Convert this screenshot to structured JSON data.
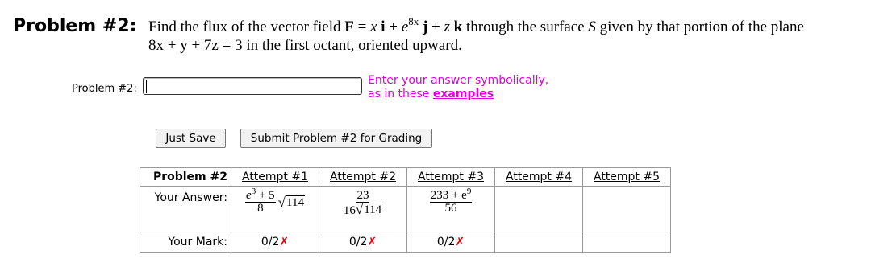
{
  "problem": {
    "label": "Problem #2:",
    "line1": {
      "pre": "Find the flux of the vector field",
      "F": "F",
      "eq": "=",
      "x": "x",
      "i": "i",
      "plus1": "+",
      "e": "e",
      "exp": "8x",
      "j": "j",
      "plus2": "+",
      "z": "z",
      "k": "k",
      "mid": "through the surface",
      "S": "S",
      "post": "given by that portion of the plane"
    },
    "line2": {
      "eqn": "8x + y + 7z = 3",
      "post": "in the first octant, oriented upward."
    }
  },
  "answer": {
    "label": "Problem #2:",
    "value": "",
    "hint_line1": "Enter your answer symbolically,",
    "hint_line2": "as in these",
    "hint_link": "examples"
  },
  "buttons": {
    "save": "Just Save",
    "submit": "Submit Problem #2 for Grading"
  },
  "attempts_table": {
    "header_label": "Problem #2",
    "answer_row_label": "Your Answer:",
    "mark_row_label": "Your Mark:",
    "attempts": [
      {
        "label": "Attempt #1",
        "mark": "0/2",
        "mark_symbol": "✗"
      },
      {
        "label": "Attempt #2",
        "mark": "0/2",
        "mark_symbol": "✗"
      },
      {
        "label": "Attempt #3",
        "mark": "0/2",
        "mark_symbol": "✗"
      },
      {
        "label": "Attempt #4",
        "mark": "",
        "mark_symbol": ""
      },
      {
        "label": "Attempt #5",
        "mark": "",
        "mark_symbol": ""
      }
    ],
    "answer1": {
      "num_base": "e",
      "num_exp": "3",
      "num_rest": "+ 5",
      "den": "8",
      "radicand": "114"
    },
    "answer2": {
      "num": "23",
      "den_coef": "16",
      "radicand": "114"
    },
    "answer3": {
      "num_base": "233 + e",
      "num_exp": "9",
      "den": "56"
    }
  },
  "colors": {
    "hint": "#e000e0",
    "wrong_mark": "#e00000"
  }
}
